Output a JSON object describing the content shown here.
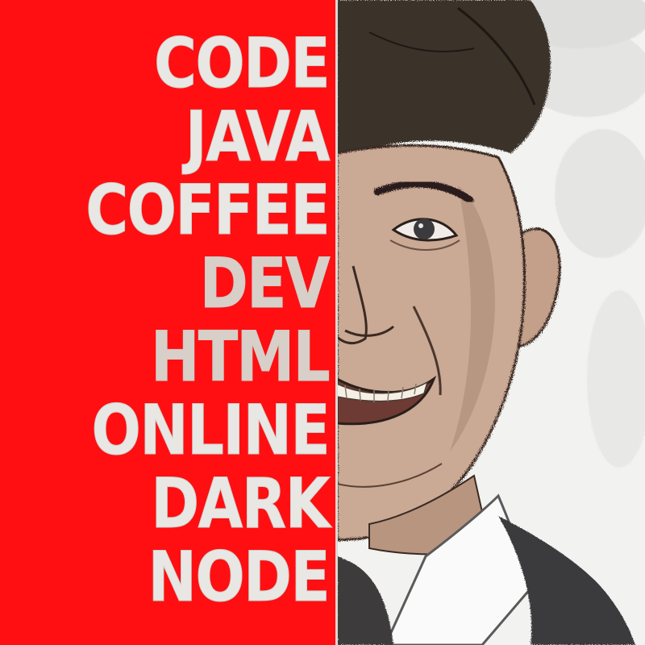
{
  "poster": {
    "words": [
      "CODE",
      "JAVA",
      "COFFEE",
      "DEV",
      "HTML",
      "ONLINE",
      "DARK",
      "NODE"
    ]
  },
  "colors": {
    "panel_red": "#ff0f12",
    "text_light": "#e9e7e4",
    "ink": "#2a211d",
    "skin": "#c9a996",
    "background": "#f3f3f1"
  },
  "image": {
    "subject": "portrait-illustration"
  }
}
